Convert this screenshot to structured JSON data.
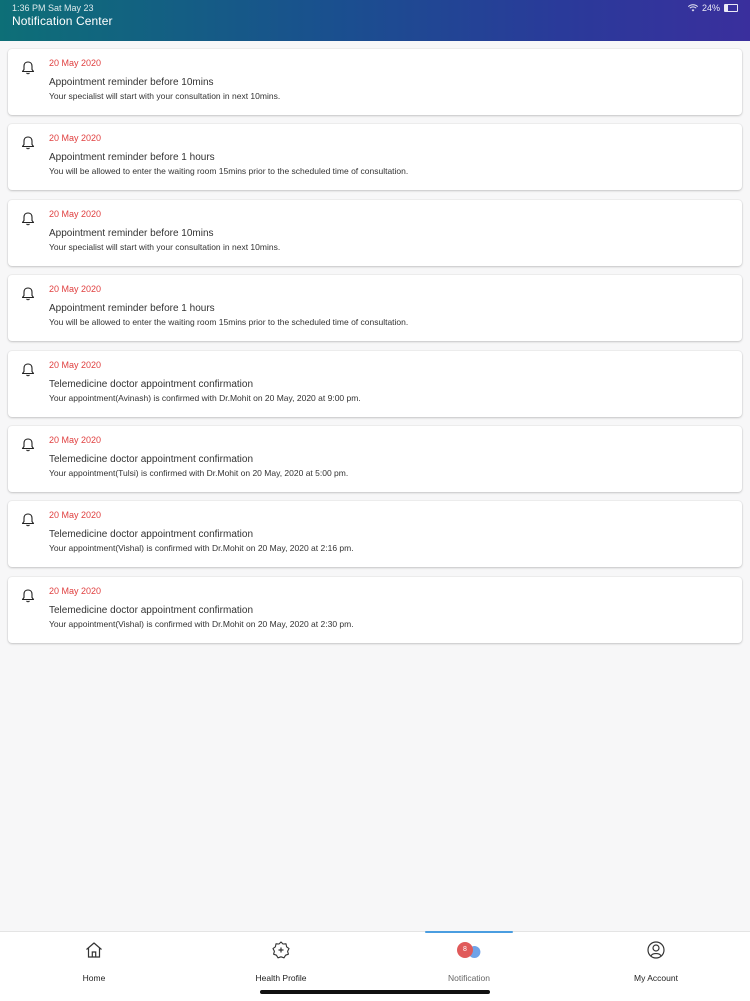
{
  "status_bar": {
    "time": "1:36 PM  Sat May 23",
    "battery": "24%"
  },
  "header": {
    "title": "Notification Center"
  },
  "notifications": [
    {
      "date": "20 May 2020",
      "title": "Appointment reminder before 10mins",
      "body": "Your specialist will start with your consultation in next 10mins."
    },
    {
      "date": "20 May 2020",
      "title": "Appointment reminder before 1 hours",
      "body": "You will be allowed to enter the waiting room 15mins prior to the scheduled time of consultation."
    },
    {
      "date": "20 May 2020",
      "title": "Appointment reminder before 10mins",
      "body": "Your specialist will start with your consultation in next 10mins."
    },
    {
      "date": "20 May 2020",
      "title": "Appointment reminder before 1 hours",
      "body": "You will be allowed to enter the waiting room 15mins prior to the scheduled time of consultation."
    },
    {
      "date": "20 May 2020",
      "title": "Telemedicine doctor appointment confirmation",
      "body": "Your appointment(Avinash) is confirmed with Dr.Mohit on 20 May, 2020 at 9:00 pm."
    },
    {
      "date": "20 May 2020",
      "title": "Telemedicine doctor appointment confirmation",
      "body": "Your appointment(Tulsi) is confirmed with Dr.Mohit on 20 May, 2020 at 5:00 pm."
    },
    {
      "date": "20 May 2020",
      "title": "Telemedicine doctor appointment confirmation",
      "body": "Your appointment(Vishal) is confirmed with Dr.Mohit on 20 May, 2020 at 2:16 pm."
    },
    {
      "date": "20 May 2020",
      "title": "Telemedicine doctor appointment confirmation",
      "body": "Your appointment(Vishal) is confirmed with Dr.Mohit on 20 May, 2020 at 2:30 pm."
    }
  ],
  "tabbar": {
    "home": {
      "label": "Home",
      "icon": "home-icon"
    },
    "health_profile": {
      "label": "Health Profile",
      "icon": "health-profile-icon"
    },
    "notification": {
      "label": "Notification",
      "icon": "notification-icon",
      "badge": "8"
    },
    "my_account": {
      "label": "My Account",
      "icon": "account-icon"
    }
  },
  "colors": {
    "date_red": "#e04040",
    "tab_indicator": "#4a9de0",
    "badge": "#e05a5a"
  }
}
